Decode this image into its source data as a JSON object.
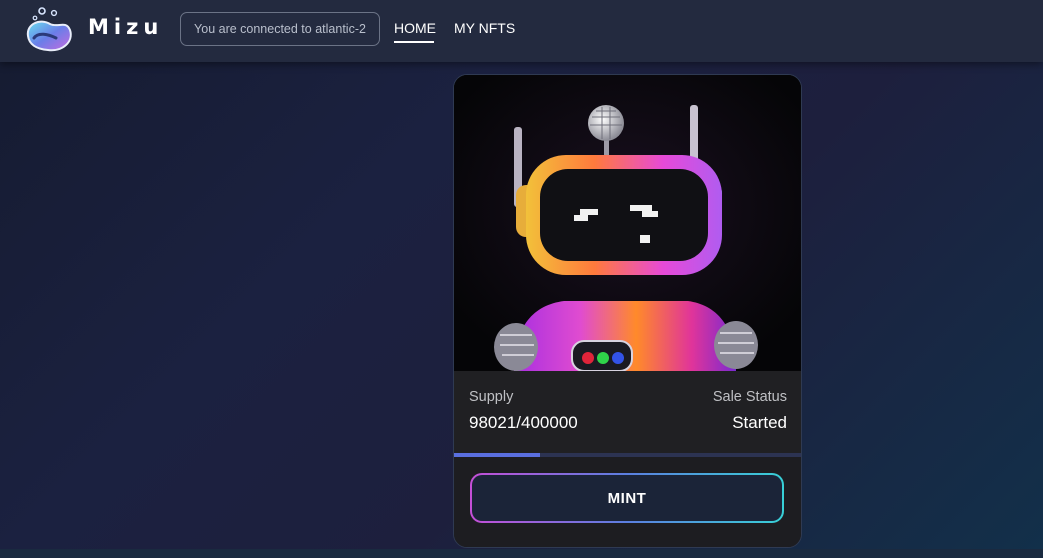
{
  "header": {
    "brand": "Mizu",
    "network_status": "You are connected to atlantic-2",
    "nav": [
      {
        "label": "HOME",
        "active": true
      },
      {
        "label": "MY NFTS",
        "active": false
      }
    ]
  },
  "nft_card": {
    "image_icon": "robot-nft-art",
    "supply_label": "Supply",
    "supply_value": "98021/400000",
    "supply_progress_fraction": 0.245,
    "status_label": "Sale Status",
    "status_value": "Started",
    "mint_label": "MINT"
  },
  "colors": {
    "header_bg": "#232a3f",
    "accent_progress": "#5a6fe0",
    "mint_border_start": "#c44fd7",
    "mint_border_end": "#38d0d6"
  }
}
